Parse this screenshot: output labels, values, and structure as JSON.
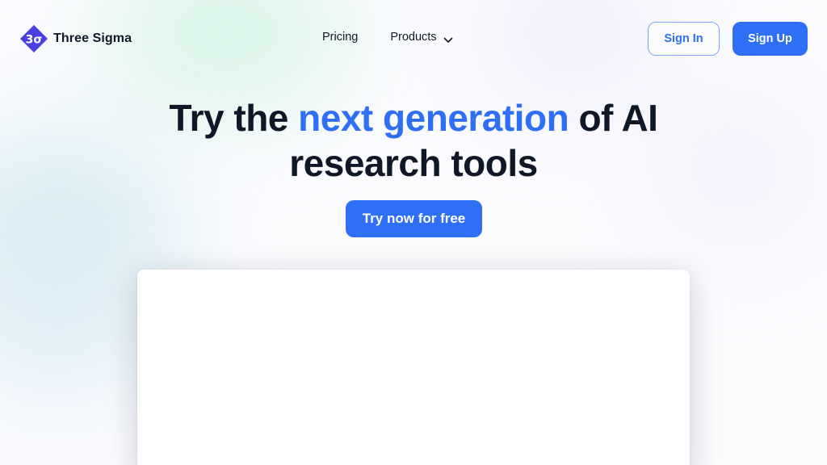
{
  "brand": {
    "name": "Three Sigma",
    "logo_glyph": "3σ",
    "logo_color": "#4b3fe0"
  },
  "nav": {
    "items": [
      {
        "label": "Pricing"
      },
      {
        "label": "Products"
      }
    ]
  },
  "auth": {
    "sign_in_label": "Sign In",
    "sign_up_label": "Sign Up"
  },
  "hero": {
    "title_part1": "Try the ",
    "title_accent": "next generation",
    "title_part2": " of AI",
    "title_line2": "research tools",
    "cta_label": "Try now for free"
  },
  "colors": {
    "accent": "#2f6ff5",
    "text": "#101828"
  }
}
